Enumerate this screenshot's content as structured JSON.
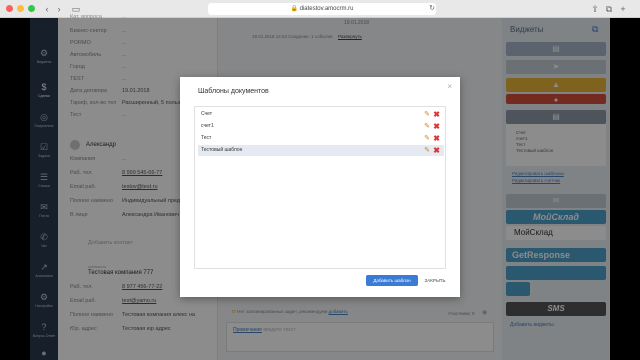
{
  "browser": {
    "url": "diatestov.amocrm.ru"
  },
  "sidebar": {
    "items": [
      {
        "label": "Виджеты"
      },
      {
        "label": "Сделки"
      },
      {
        "label": "Покупатели"
      },
      {
        "label": "Задачи"
      },
      {
        "label": "Списки"
      },
      {
        "label": "Почта"
      },
      {
        "label": "Чат"
      },
      {
        "label": "Аналитика"
      },
      {
        "label": "Настройки"
      },
      {
        "label": "Вопрос-Ответ"
      }
    ]
  },
  "card": {
    "fields": [
      {
        "label": "Кат. вопроса",
        "value": "..."
      },
      {
        "label": "Бизнес-сектор",
        "value": "..."
      },
      {
        "label": "PORMO",
        "value": "..."
      },
      {
        "label": "Автомобиль",
        "value": "..."
      },
      {
        "label": "Город",
        "value": "..."
      },
      {
        "label": "TEST",
        "value": "..."
      },
      {
        "label": "Дата договора",
        "value": "19.01.2018"
      },
      {
        "label": "Тариф, кол-во тел",
        "value": "Расширенный, 5 польз..."
      },
      {
        "label": "Тест",
        "value": "..."
      }
    ],
    "contact": {
      "name": "Александр",
      "fields": [
        {
          "label": "Компания",
          "value": "..."
        },
        {
          "label": "Раб. тел.",
          "value": "8 999 545-66-77"
        },
        {
          "label": "Email раб.",
          "value": "testov@test.ru"
        },
        {
          "label": "Полное наимено",
          "value": "Индивидуальный пред..."
        },
        {
          "label": "В лице",
          "value": "Александра Иванович"
        }
      ],
      "add_link": "Добавить контакт"
    },
    "company": {
      "caption": "компания",
      "name": "Тестовая компания 777",
      "fields": [
        {
          "label": "Раб. тел.",
          "value": "8 977 456-77-22"
        },
        {
          "label": "Email раб.",
          "value": "test@yamo.ru"
        },
        {
          "label": "Полное наимено",
          "value": "Тестовая компания алекс на"
        },
        {
          "label": "Юр. адрес",
          "value": "Тестовая юр адрес"
        }
      ]
    }
  },
  "feed": {
    "date": "19.01.2018",
    "event": "19.01.2018 14:53 Создание: 1 событие",
    "event_link": "Развернуть",
    "notice": "Нет запланированных задач, рекомендуем",
    "notice_link": "добавить",
    "input_label": "Примечание",
    "input_placeholder": "введите текст",
    "subscribers": "Участники: 0"
  },
  "widgets": {
    "title": "Виджеты",
    "doc_templates": [
      "Счет",
      "счет1",
      "Тест",
      "Тестовый шаблон"
    ],
    "doc_links": [
      "Редактировать шаблоны",
      "Редактировать счетчик"
    ],
    "moysklad": "МойСклад",
    "getresponse": "GetResponse",
    "sms": "SMS",
    "add_link": "Добавить виджеты"
  },
  "modal": {
    "title": "Шаблоны документов",
    "items": [
      "Счет",
      "счет1",
      "Тест",
      "Тестовый шаблон"
    ],
    "add_button": "Добавить шаблон",
    "close_button": "ЗАКРЫТЬ"
  }
}
